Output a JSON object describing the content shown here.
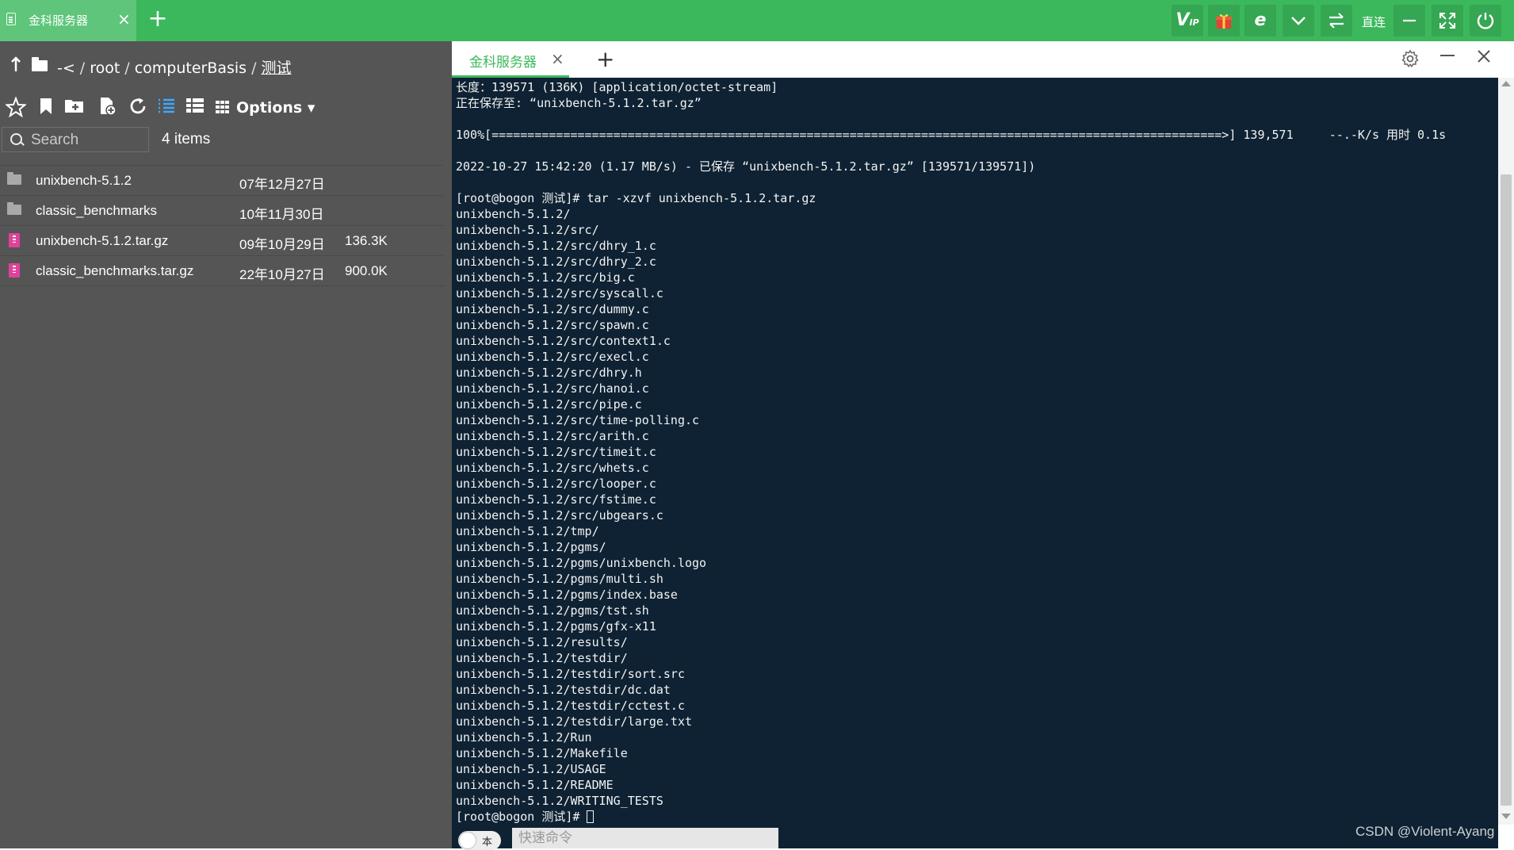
{
  "app": {
    "tab_title": "金科服务器",
    "tab_close": "×",
    "new_tab": "+",
    "direct_label": "直连"
  },
  "breadcrumb": {
    "root": "-<",
    "parts": [
      "root",
      "computerBasis",
      "测试"
    ]
  },
  "toolbar": {
    "options_label": "Options ▾"
  },
  "search": {
    "placeholder": "Search"
  },
  "items_count": "4 items",
  "files": [
    {
      "name": "unixbench-5.1.2",
      "date": "07年12月27日",
      "size": "",
      "type": "folder"
    },
    {
      "name": "classic_benchmarks",
      "date": "10年11月30日",
      "size": "",
      "type": "folder"
    },
    {
      "name": "unixbench-5.1.2.tar.gz",
      "date": "09年10月29日",
      "size": "136.3K",
      "type": "archive"
    },
    {
      "name": "classic_benchmarks.tar.gz",
      "date": "22年10月27日",
      "size": "900.0K",
      "type": "archive"
    }
  ],
  "terminal_tab": {
    "label": "金科服务器",
    "close": "×",
    "new_tab": "+"
  },
  "terminal": {
    "lines": [
      "长度：139571 (136K) [application/octet-stream]",
      "正在保存至: “unixbench-5.1.2.tar.gz”",
      "",
      "100%[======================================================================================================>] 139,571     --.-K/s 用时 0.1s",
      "",
      "2022-10-27 15:42:20 (1.17 MB/s) - 已保存 “unixbench-5.1.2.tar.gz” [139571/139571])",
      "",
      "[root@bogon 测试]# tar -xzvf unixbench-5.1.2.tar.gz",
      "unixbench-5.1.2/",
      "unixbench-5.1.2/src/",
      "unixbench-5.1.2/src/dhry_1.c",
      "unixbench-5.1.2/src/dhry_2.c",
      "unixbench-5.1.2/src/big.c",
      "unixbench-5.1.2/src/syscall.c",
      "unixbench-5.1.2/src/dummy.c",
      "unixbench-5.1.2/src/spawn.c",
      "unixbench-5.1.2/src/context1.c",
      "unixbench-5.1.2/src/execl.c",
      "unixbench-5.1.2/src/dhry.h",
      "unixbench-5.1.2/src/hanoi.c",
      "unixbench-5.1.2/src/pipe.c",
      "unixbench-5.1.2/src/time-polling.c",
      "unixbench-5.1.2/src/arith.c",
      "unixbench-5.1.2/src/timeit.c",
      "unixbench-5.1.2/src/whets.c",
      "unixbench-5.1.2/src/looper.c",
      "unixbench-5.1.2/src/fstime.c",
      "unixbench-5.1.2/src/ubgears.c",
      "unixbench-5.1.2/tmp/",
      "unixbench-5.1.2/pgms/",
      "unixbench-5.1.2/pgms/unixbench.logo",
      "unixbench-5.1.2/pgms/multi.sh",
      "unixbench-5.1.2/pgms/index.base",
      "unixbench-5.1.2/pgms/tst.sh",
      "unixbench-5.1.2/pgms/gfx-x11",
      "unixbench-5.1.2/results/",
      "unixbench-5.1.2/testdir/",
      "unixbench-5.1.2/testdir/sort.src",
      "unixbench-5.1.2/testdir/dc.dat",
      "unixbench-5.1.2/testdir/cctest.c",
      "unixbench-5.1.2/testdir/large.txt",
      "unixbench-5.1.2/Run",
      "unixbench-5.1.2/Makefile",
      "unixbench-5.1.2/USAGE",
      "unixbench-5.1.2/README",
      "unixbench-5.1.2/WRITING_TESTS"
    ],
    "prompt": "[root@bogon 测试]# "
  },
  "command_bar": {
    "toggle_label": "本",
    "placeholder": "快速命令"
  },
  "watermark": "CSDN @Violent-Ayang",
  "colors": {
    "titlebar_green": "#3cb85c",
    "panel_gray": "#555555",
    "terminal_bg": "#0e2233",
    "archive_pink": "#e0419b"
  }
}
